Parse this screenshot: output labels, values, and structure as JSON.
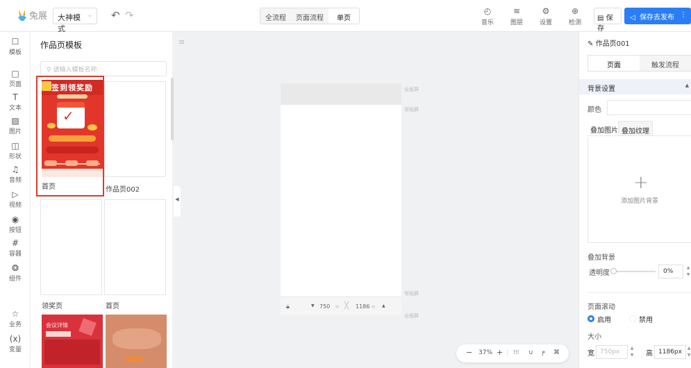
{
  "app": {
    "logo_text": "兔展",
    "mode": "大神模式",
    "flow_tabs": [
      "全流程",
      "页面流程",
      "单页"
    ],
    "tools": [
      {
        "label": "音乐",
        "icon": "music-icon"
      },
      {
        "label": "图层",
        "icon": "layers-icon"
      },
      {
        "label": "设置",
        "icon": "settings-icon"
      },
      {
        "label": "检测",
        "icon": "inspect-icon"
      }
    ],
    "save": "保存",
    "publish": "保存去发布"
  },
  "sidebar": {
    "items": [
      {
        "label": "模板",
        "icon": "template-icon",
        "glyph": "☐"
      },
      {
        "label": "页面",
        "icon": "page-icon",
        "glyph": "□"
      },
      {
        "label": "文本",
        "icon": "text-icon",
        "glyph": "T"
      },
      {
        "label": "图片",
        "icon": "image-icon",
        "glyph": "▨"
      },
      {
        "label": "形状",
        "icon": "shape-icon",
        "glyph": "◫"
      },
      {
        "label": "音频",
        "icon": "audio-icon",
        "glyph": "♫"
      },
      {
        "label": "视频",
        "icon": "video-icon",
        "glyph": "▷"
      },
      {
        "label": "按钮",
        "icon": "button-icon",
        "glyph": "◉"
      },
      {
        "label": "容器",
        "icon": "container-icon",
        "glyph": "#"
      },
      {
        "label": "组件",
        "icon": "component-icon",
        "glyph": "❂"
      },
      {
        "label": "业务",
        "icon": "business-icon",
        "glyph": "☆"
      },
      {
        "label": "变量",
        "icon": "variable-icon",
        "glyph": "(x)"
      }
    ]
  },
  "templates_panel": {
    "title": "作品页模板",
    "search_placeholder": "请输入模板名称",
    "cards": [
      {
        "name": "首页",
        "thumb_title": "签到领奖励"
      },
      {
        "name": "作品页002"
      },
      {
        "name": "领奖页"
      },
      {
        "name": "首页"
      }
    ],
    "thumb3_title": "会议详情"
  },
  "canvas": {
    "labels": {
      "full_screen_top": "全面屏",
      "normal_screen_top": "常规屏",
      "normal_screen_bottom": "常规屏",
      "full_screen_bottom": "全面屏"
    },
    "width": "750",
    "height": "1186",
    "zoom": "37%"
  },
  "right_panel": {
    "title": "作品页001",
    "tabs": [
      "页面",
      "触发流程"
    ],
    "section": "背景设置",
    "color_label": "颜色",
    "sub_tabs": [
      "叠加图片",
      "叠加纹理"
    ],
    "upload_text": "添加图片背景",
    "overlay_label": "叠加背景",
    "opacity_label": "透明度",
    "opacity_value": "0%",
    "scroll_label": "页面滚动",
    "scroll_on": "启用",
    "scroll_off": "禁用",
    "size_label": "大小",
    "width_label": "宽",
    "width_value": "750px",
    "height_label": "高",
    "height_value": "1186px"
  }
}
